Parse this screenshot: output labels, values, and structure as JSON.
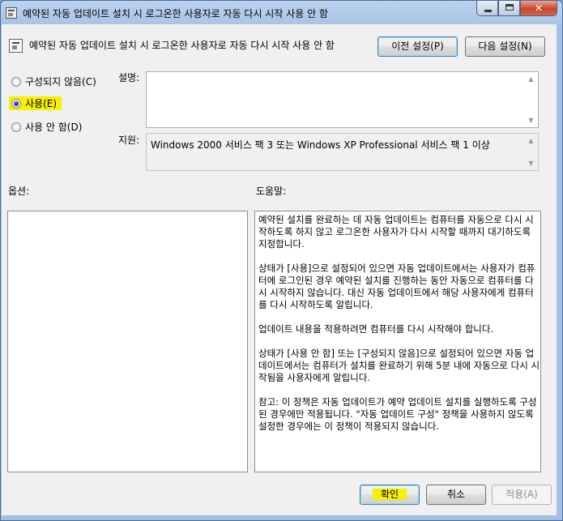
{
  "window": {
    "title": "예약된 자동 업데이트 설치 시 로그온한 사용자로 자동 다시 시작 사용 안 함"
  },
  "header": {
    "title": "예약된 자동 업데이트 설치 시 로그온한 사용자로 자동 다시 시작 사용 안 함",
    "prev_label": "이전 설정(P)",
    "next_label": "다음 설정(N)"
  },
  "radios": [
    {
      "label": "구성되지 않음(C)",
      "checked": false
    },
    {
      "label": "사용(E)",
      "checked": true,
      "highlighted": true
    },
    {
      "label": "사용 안 함(D)",
      "checked": false
    }
  ],
  "comment": {
    "label": "설명:",
    "value": ""
  },
  "supported": {
    "label": "지원:",
    "value": "Windows 2000 서비스 팩 3 또는 Windows XP Professional 서비스 팩 1 이상"
  },
  "options": {
    "label": "옵션:"
  },
  "help": {
    "label": "도움말:",
    "paragraphs": [
      "예약된 설치를 완료하는 데 자동 업데이트는 컴퓨터를 자동으로 다시 시작하도록 하지 않고 로그온한 사용자가 다시 시작할 때까지 대기하도록 지정합니다.",
      "상태가 [사용]으로 설정되어 있으면 자동 업데이트에서는 사용자가 컴퓨터에 로그인된 경우 예약된 설치를 진행하는 동안 자동으로 컴퓨터를 다시 시작하지 않습니다. 대신 자동 업데이트에서 해당 사용자에게 컴퓨터를 다시 시작하도록 알립니다.",
      "업데이트 내용을 적용하려면 컴퓨터를 다시 시작해야 합니다.",
      "상태가 [사용 안 함] 또는 [구성되지 않음]으로 설정되어 있으면 자동 업데이트에서는 컴퓨터가 설치를 완료하기 위해 5분 내에 자동으로 다시 시작됨을 사용자에게 알립니다.",
      "참고: 이 정책은 자동 업데이트가 예약 업데이트 설치를 실행하도록 구성된 경우에만 적용됩니다. \"자동 업데이트 구성\" 정책을 사용하지 않도록 설정한 경우에는 이 정책이 적용되지 않습니다."
    ]
  },
  "footer": {
    "ok_label": "확인",
    "cancel_label": "취소",
    "apply_label": "적용(A)"
  },
  "icons": {
    "minimize": "minimize-icon",
    "maximize": "maximize-icon",
    "close": "close-icon",
    "policy": "policy-setting-icon"
  },
  "colors": {
    "highlight": "#f7f000",
    "titlebar": "#a4c0e4",
    "close_button": "#c8452e"
  }
}
